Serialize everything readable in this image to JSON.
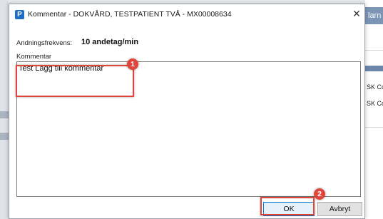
{
  "background_app": {
    "right_tab_text": "larn",
    "right_row_texts": [
      "SK Co",
      "SK Co"
    ]
  },
  "dialog": {
    "app_icon_letter": "P",
    "title": "Kommentar - DOKVÅRD, TESTPATIENT TVÅ - MX00008634",
    "close_symbol": "✕",
    "frequency_label": "Andningsfrekvens:",
    "frequency_value": "10 andetag/min",
    "comment_label": "Kommentar",
    "comment_value": "Test Lägg till kommentar",
    "ok_label": "OK",
    "cancel_label": "Avbryt"
  },
  "annotations": {
    "badge_1": "1",
    "badge_2": "2",
    "highlight_color": "#e0453c"
  }
}
